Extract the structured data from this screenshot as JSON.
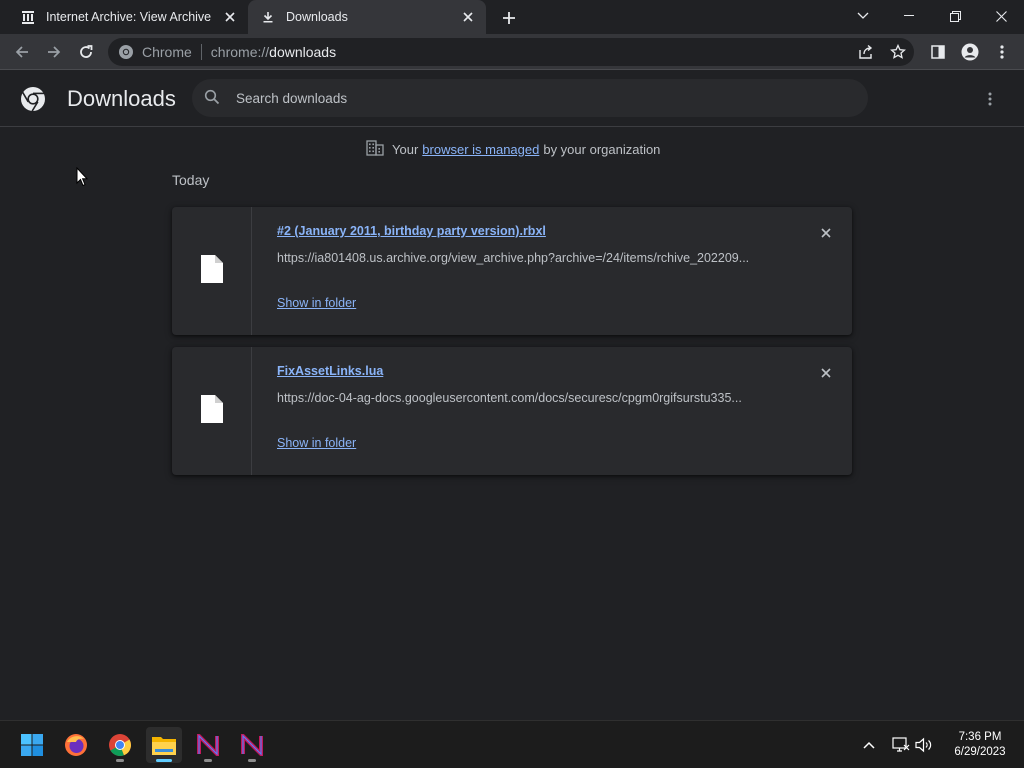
{
  "tabs": [
    {
      "title": "Internet Archive: View Archive",
      "active": false
    },
    {
      "title": "Downloads",
      "active": true
    }
  ],
  "omnibox": {
    "chip": "Chrome",
    "scheme": "chrome://",
    "path": "downloads"
  },
  "downloads_page": {
    "title": "Downloads",
    "search_placeholder": "Search downloads",
    "managed_prefix": "Your",
    "managed_link": "browser is managed",
    "managed_suffix": "by your organization",
    "section_date": "Today",
    "items": [
      {
        "filename": "#2 (January 2011, birthday party version).rbxl",
        "url": "https://ia801408.us.archive.org/view_archive.php?archive=/24/items/rchive_202209...",
        "action": "Show in folder"
      },
      {
        "filename": "FixAssetLinks.lua",
        "url": "https://doc-04-ag-docs.googleusercontent.com/docs/securesc/cpgm0rgifsurstu335...",
        "action": "Show in folder"
      }
    ]
  },
  "taskbar": {
    "apps": [
      "windows-start",
      "firefox",
      "chrome",
      "file-explorer",
      "app-n-1",
      "app-n-2"
    ],
    "time": "7:36 PM",
    "date": "6/29/2023"
  },
  "colors": {
    "background": "#202124",
    "toolbar": "#35363a",
    "card": "#292a2d",
    "link": "#8ab4f8",
    "text": "#e8eaed",
    "muted": "#bdc1c6",
    "taskbar": "#1c1c1c"
  }
}
